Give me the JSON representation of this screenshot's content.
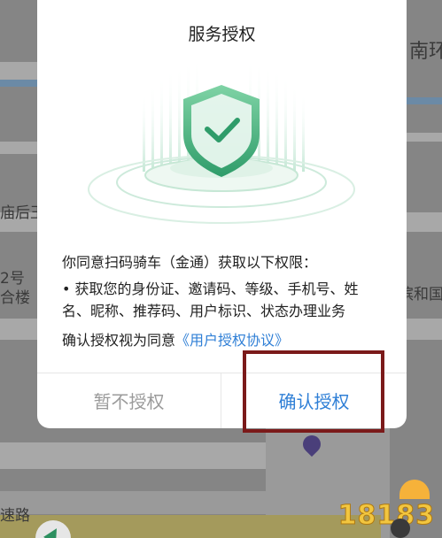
{
  "map": {
    "labels": [
      "南环",
      "庙后王",
      "2号",
      "合楼",
      "滨和国",
      "速路"
    ]
  },
  "dialog": {
    "title": "服务授权",
    "intro": "你同意扫码骑车（金通）获取以下权限：",
    "permissions": "• 获取您的身份证、邀请码、等级、手机号、姓名、昵称、推荐码、用户标识、状态办理业务",
    "agree_prefix": "确认授权视为同意",
    "agree_link": "《用户授权协议》",
    "deny_label": "暂不授权",
    "confirm_label": "确认授权"
  },
  "watermark": {
    "text": "18183"
  },
  "colors": {
    "accent": "#2f7fd6",
    "shield": "#3ca878",
    "highlight": "#7b1a1a"
  }
}
